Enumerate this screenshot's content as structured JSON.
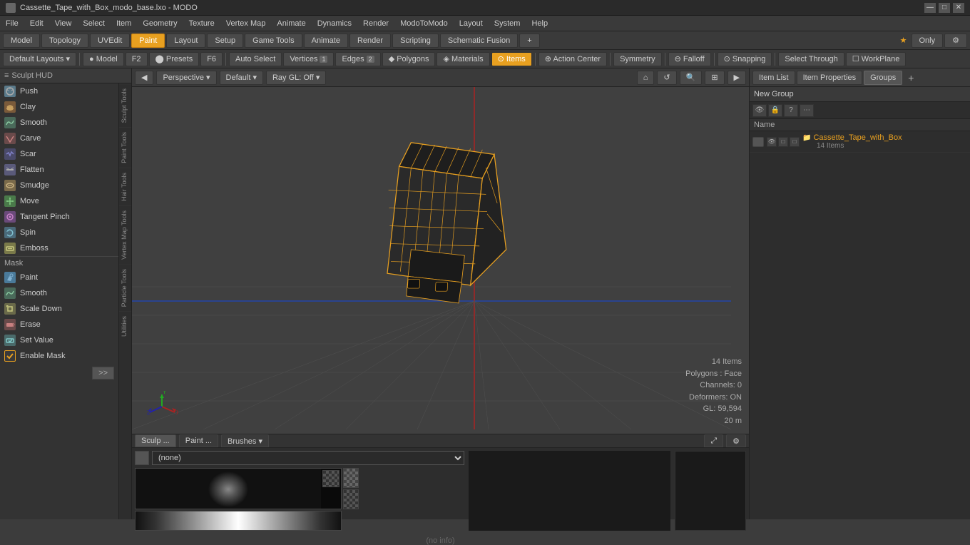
{
  "titlebar": {
    "title": "Cassette_Tape_with_Box_modo_base.lxo - MODO",
    "icon": "modo-icon"
  },
  "titlebar_controls": {
    "minimize": "—",
    "maximize": "□",
    "close": "✕"
  },
  "menubar": {
    "items": [
      "File",
      "Edit",
      "View",
      "Select",
      "Item",
      "Geometry",
      "Texture",
      "Vertex Map",
      "Animate",
      "Dynamics",
      "Render",
      "ModoToModo",
      "Layout",
      "System",
      "Help"
    ]
  },
  "toolbar1": {
    "buttons": [
      "Model",
      "Topology",
      "UVEdit",
      "Paint",
      "Layout",
      "Setup",
      "Game Tools",
      "Animate",
      "Render",
      "Scripting",
      "Schematic Fusion"
    ],
    "active": "Paint",
    "right": {
      "star_label": "★ Only",
      "gear": "⚙"
    }
  },
  "toolbar2": {
    "layout_label": "Default Layouts",
    "buttons": [
      {
        "label": "● Model",
        "active": false
      },
      {
        "label": "F2",
        "active": false
      },
      {
        "label": "⬤ Presets",
        "active": false
      },
      {
        "label": "F6",
        "active": false
      },
      {
        "label": "Auto Select",
        "active": false
      },
      {
        "label": "Vertices",
        "number": "1",
        "active": false
      },
      {
        "label": "Edges",
        "number": "2",
        "active": false
      },
      {
        "label": "Polygons",
        "active": false
      },
      {
        "label": "Materials",
        "active": false
      },
      {
        "label": "Items",
        "active": true
      },
      {
        "label": "Action Center",
        "active": false
      },
      {
        "label": "Symmetry",
        "active": false
      },
      {
        "label": "Falloff",
        "active": false
      },
      {
        "label": "Snapping",
        "active": false
      },
      {
        "label": "Select Through",
        "active": false
      },
      {
        "label": "WorkPlane",
        "active": false
      }
    ]
  },
  "sculpt_hud": "Sculpt HUD",
  "tools": {
    "sculpt_tools": [
      {
        "label": "Push",
        "icon": "push-icon"
      },
      {
        "label": "Clay",
        "icon": "clay-icon"
      },
      {
        "label": "Smooth",
        "icon": "smooth-icon"
      },
      {
        "label": "Carve",
        "icon": "carve-icon"
      },
      {
        "label": "Scar",
        "icon": "scar-icon"
      },
      {
        "label": "Flatten",
        "icon": "flatten-icon"
      },
      {
        "label": "Smudge",
        "icon": "smudge-icon"
      },
      {
        "label": "Move",
        "icon": "move-icon"
      },
      {
        "label": "Tangent Pinch",
        "icon": "tangent-pinch-icon"
      },
      {
        "label": "Spin",
        "icon": "spin-icon"
      },
      {
        "label": "Emboss",
        "icon": "emboss-icon"
      }
    ],
    "mask_tools": [
      {
        "label": "Paint",
        "icon": "paint-icon"
      },
      {
        "label": "Smooth",
        "icon": "smooth-mask-icon"
      },
      {
        "label": "Scale Down",
        "icon": "scale-down-icon"
      }
    ],
    "utility_tools": [
      {
        "label": "Erase",
        "icon": "erase-icon"
      },
      {
        "label": "Set Value",
        "icon": "set-value-icon"
      },
      {
        "label": "Enable Mask",
        "icon": "enable-mask-icon",
        "is_toggle": true
      }
    ]
  },
  "vertical_tabs": [
    "Sculpt Tools",
    "Paint Tools",
    "Hair Tools",
    "Vertex Map Tools",
    "Particle Tools",
    "Utilities"
  ],
  "viewport": {
    "perspective_label": "Perspective",
    "default_label": "Default",
    "ray_gl_label": "Ray GL: Off",
    "nav_buttons": [
      "◀",
      "↺",
      "🔍",
      "⊞",
      "▶"
    ],
    "info": {
      "items_count": "14 Items",
      "polygons": "Polygons : Face",
      "channels": "Channels: 0",
      "deformers": "Deformers: ON",
      "gl": "GL: 59,594",
      "scale": "20 m"
    }
  },
  "right_panel": {
    "tabs": [
      "Item List",
      "Item Properties",
      "Groups"
    ],
    "active_tab": "Groups",
    "add_button": "+",
    "new_group_label": "New Group",
    "toolbar_buttons": [
      "👁",
      "🔒",
      "?",
      "?"
    ],
    "name_header": "Name",
    "items": [
      {
        "name": "Cassette_Tape_with_Box",
        "sub": "14 Items",
        "color": "#e8a020"
      }
    ]
  },
  "bottom_panel": {
    "tabs": [
      {
        "label": "Sculp ...",
        "active": true
      },
      {
        "label": "Paint ...",
        "active": false
      },
      {
        "label": "Brushes",
        "active": false,
        "has_arrow": true
      }
    ],
    "expand_icon": "⤢",
    "settings_icon": "⚙",
    "brush_dropdown": {
      "placeholder": "(none)",
      "value": "(none)"
    },
    "no_info": "(no info)"
  },
  "colors": {
    "accent": "#e8a020",
    "bg_dark": "#2a2a2a",
    "bg_mid": "#3a3a3a",
    "bg_light": "#4a4a4a",
    "text_primary": "#d0d0d0",
    "text_secondary": "#aaaaaa",
    "border": "#222222"
  }
}
